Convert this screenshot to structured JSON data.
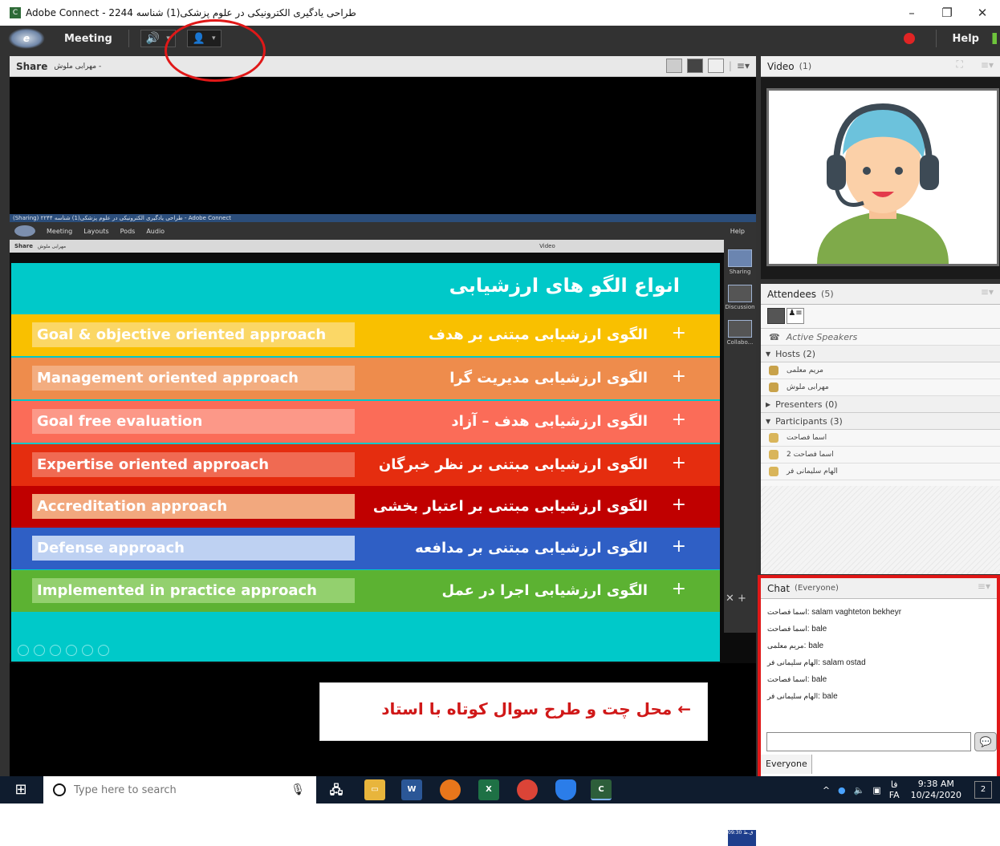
{
  "window": {
    "title": "Adobe Connect - طراحی یادگیری الکترونیکی در علوم پزشکی(1) شناسه 2244",
    "app_icon": "adobe-connect-icon",
    "buttons": [
      "–",
      "❐",
      "✕"
    ]
  },
  "menubar": {
    "menu_label": "Meeting",
    "help_label": "Help",
    "speaker_icon": "🔊",
    "user_icon": "👤"
  },
  "share_pod": {
    "title": "Share",
    "presenter": "مهرابی ملوش -",
    "menu_glyph": "≡▾"
  },
  "inner_screen": {
    "title": "(Sharing) طراحی یادگیری الکترونیکی در علوم پزشکی(1) شناسه ۲۲۴۴ - Adobe Connect",
    "menus": [
      "Meeting",
      "Layouts",
      "Pods",
      "Audio"
    ],
    "help": "Help",
    "share": "Share",
    "share_sub": "مهرابی ملوش",
    "video": "Video",
    "layouts": [
      "Sharing",
      "Discussion",
      "Collabo..."
    ],
    "time": "09:30 ق.ظ"
  },
  "slide": {
    "title": "انواع الگو های ارزشیابی",
    "rows": [
      {
        "en": "Goal & objective oriented approach",
        "fa": "الگوی ارزشیابی مبتنی بر هدف",
        "bg": "#f9c000",
        "box": "#fbd766"
      },
      {
        "en": "Management oriented approach",
        "fa": "الگوی ارزشیابی مدیریت گرا",
        "bg": "#ee8c4c",
        "box": "#f3ad80"
      },
      {
        "en": "Goal free evaluation",
        "fa": "الگوی ارزشیابی هدف  – آزاد",
        "bg": "#fb6c58",
        "box": "#fc9888"
      },
      {
        "en": "Expertise oriented approach",
        "fa": "الگوی ارزشیابی مبتنی بر نظر خبرگان",
        "bg": "#e52d0f",
        "box": "#f06a52"
      },
      {
        "en": "Accreditation approach",
        "fa": "الگوی ارزشیابی مبتنی بر اعتبار بخشی",
        "bg": "#c00000",
        "box": "#f2a87e"
      },
      {
        "en": "Defense approach",
        "fa": "الگوی ارزشیابی مبتنی بر مدافعه",
        "bg": "#2f5fc5",
        "box": "#bed1f2"
      },
      {
        "en": "Implemented in practice approach",
        "fa": "الگوی ارزشیابی اجرا در عمل",
        "bg": "#5cb232",
        "box": "#93d06e"
      }
    ],
    "plus": "+"
  },
  "callout": {
    "text": "← محل چت و طرح سوال کوتاه با استاد"
  },
  "video_pod": {
    "title": "Video",
    "count": "(1)"
  },
  "attendees_pod": {
    "title": "Attendees",
    "count": "(5)",
    "active_speakers": "Active Speakers",
    "hosts_label": "Hosts (2)",
    "hosts": [
      "مریم معلمی",
      "مهرابی ملوش"
    ],
    "presenters_label": "Presenters (0)",
    "participants_label": "Participants (3)",
    "participants": [
      "اسما فصاحت",
      "اسما فصاحت 2",
      "الهام سلیمانی فر"
    ]
  },
  "chat_pod": {
    "title": "Chat",
    "scope": "(Everyone)",
    "messages": [
      {
        "who": "اسما فصاحت",
        "text": ": salam vaghteton bekheyr"
      },
      {
        "who": "اسما فصاحت",
        "text": ": bale"
      },
      {
        "who": "مریم معلمی",
        "text": ": bale"
      },
      {
        "who": "الهام سلیمانی فر",
        "text": ": salam ostad"
      },
      {
        "who": "اسما فصاحت",
        "text": ": bale"
      },
      {
        "who": "الهام سلیمانی فر",
        "text": ": bale"
      }
    ],
    "send_icon": "💬",
    "audience": "Everyone"
  },
  "taskbar": {
    "search_placeholder": "Type here to search",
    "apps": [
      "mic-icon",
      "network-icon",
      "file-explorer-icon",
      "word-icon",
      "firefox-icon",
      "excel-icon",
      "chrome-icon",
      "shield-icon",
      "adobe-connect-icon"
    ],
    "tray_up": "^",
    "lang": "FA",
    "lang_sub": "فا",
    "time": "9:38 AM",
    "date": "10/24/2020",
    "notify": "2"
  },
  "colors": {
    "accent_red": "#e01818",
    "slide_bg": "#00c9c9",
    "dark_ui": "#323232"
  }
}
